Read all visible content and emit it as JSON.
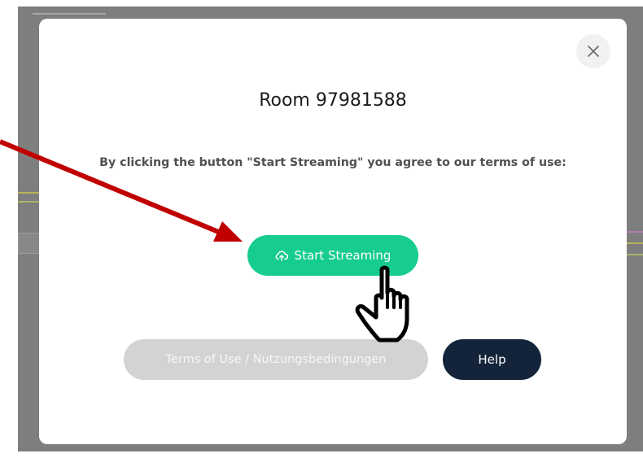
{
  "modal": {
    "title": "Room 97981588",
    "agreement_text": "By clicking the button \"Start Streaming\" you agree to our terms of use:",
    "close_icon": "close-icon"
  },
  "buttons": {
    "start_streaming": {
      "label": "Start Streaming",
      "icon": "cloud-upload-icon"
    },
    "terms": {
      "label": "Terms of Use / Nutzungsbedingungen"
    },
    "help": {
      "label": "Help"
    }
  },
  "annotations": {
    "arrow_icon": "red-arrow",
    "cursor_icon": "hand-pointer-icon"
  },
  "colors": {
    "primary_green": "#16cc8f",
    "help_navy": "#13233a",
    "terms_disabled": "#d3d3d3",
    "annotation_red": "#c00000",
    "backdrop": "#7e7e7e"
  }
}
